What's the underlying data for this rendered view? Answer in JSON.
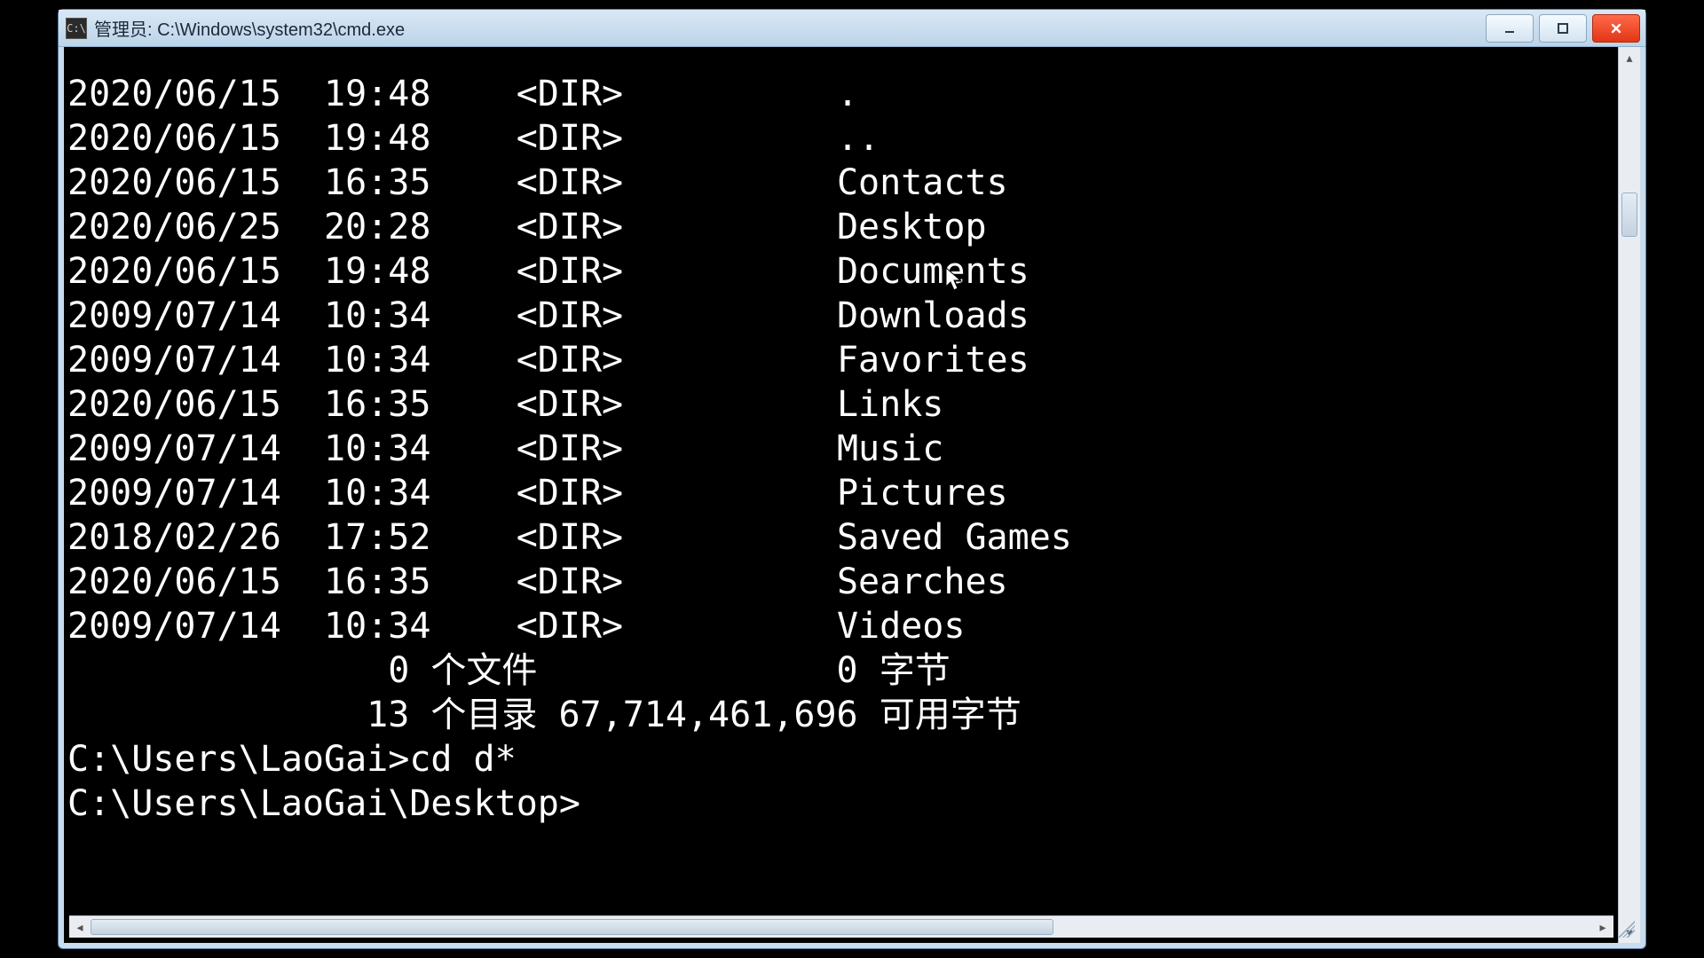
{
  "window": {
    "title": "管理员: C:\\Windows\\system32\\cmd.exe"
  },
  "dir_listing": {
    "columns": {
      "date_width": 11,
      "time_width": 6,
      "type_width": 7,
      "gap": "          "
    },
    "rows": [
      {
        "date": "2020/06/15",
        "time": "19:48",
        "type": "<DIR>",
        "name": "."
      },
      {
        "date": "2020/06/15",
        "time": "19:48",
        "type": "<DIR>",
        "name": ".."
      },
      {
        "date": "2020/06/15",
        "time": "16:35",
        "type": "<DIR>",
        "name": "Contacts"
      },
      {
        "date": "2020/06/25",
        "time": "20:28",
        "type": "<DIR>",
        "name": "Desktop"
      },
      {
        "date": "2020/06/15",
        "time": "19:48",
        "type": "<DIR>",
        "name": "Documents"
      },
      {
        "date": "2009/07/14",
        "time": "10:34",
        "type": "<DIR>",
        "name": "Downloads"
      },
      {
        "date": "2009/07/14",
        "time": "10:34",
        "type": "<DIR>",
        "name": "Favorites"
      },
      {
        "date": "2020/06/15",
        "time": "16:35",
        "type": "<DIR>",
        "name": "Links"
      },
      {
        "date": "2009/07/14",
        "time": "10:34",
        "type": "<DIR>",
        "name": "Music"
      },
      {
        "date": "2009/07/14",
        "time": "10:34",
        "type": "<DIR>",
        "name": "Pictures"
      },
      {
        "date": "2018/02/26",
        "time": "17:52",
        "type": "<DIR>",
        "name": "Saved Games"
      },
      {
        "date": "2020/06/15",
        "time": "16:35",
        "type": "<DIR>",
        "name": "Searches"
      },
      {
        "date": "2009/07/14",
        "time": "10:34",
        "type": "<DIR>",
        "name": "Videos"
      }
    ],
    "summary": {
      "files_line": "               0 个文件              0 字节",
      "dirs_line": "              13 个目录 67,714,461,696 可用字节"
    }
  },
  "prompts": {
    "line1": "C:\\Users\\LaoGai>cd d*",
    "line2": "C:\\Users\\LaoGai\\Desktop>"
  }
}
